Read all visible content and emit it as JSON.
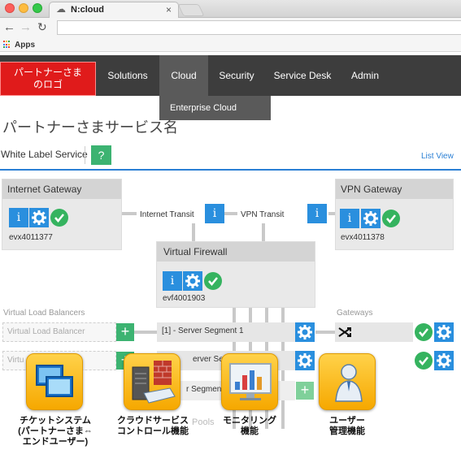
{
  "browser": {
    "tab_title": "N:cloud",
    "tab_close": "×",
    "apps_label": "Apps"
  },
  "navbar": {
    "logo_text": "パートナーさまのロゴ",
    "items": [
      {
        "label": "Solutions"
      },
      {
        "label": "Cloud"
      },
      {
        "label": "Security"
      },
      {
        "label": "Service Desk"
      },
      {
        "label": "Admin"
      }
    ],
    "dropdown_item": "Enterprise Cloud"
  },
  "page": {
    "title": "パートナーさまサービス名",
    "service_label": "White Label Service",
    "help_label": "?",
    "list_view": "List View"
  },
  "diagram": {
    "internet_gateway": {
      "title": "Internet Gateway",
      "id": "evx4011377"
    },
    "vpn_gateway": {
      "title": "VPN Gateway",
      "id": "evx4011378"
    },
    "internet_transit": "Internet Transit",
    "vpn_transit": "VPN Transit",
    "virtual_firewall": {
      "title": "Virtual Firewall",
      "id": "evf4001903"
    },
    "info_label": "i",
    "vlb_section": "Virtual Load Balancers",
    "vlb_item_1": "Virtual Load Balancer",
    "vlb_item_2": "Virtu",
    "gateways_section": "Gateways",
    "segment_1": "[1] - Server Segment 1",
    "segment_2": "erver Segm",
    "segment_3": "r Segment",
    "pools_label": "Pools",
    "plus_label": "+"
  },
  "features": [
    {
      "caption": "チケットシステム\n(パートナーさま⇔\nエンドユーザー)"
    },
    {
      "caption": "クラウドサービス\nコントロール機能"
    },
    {
      "caption": "モニタリング\n機能"
    },
    {
      "caption": "ユーザー\n管理機能"
    }
  ],
  "colors": {
    "brand_red": "#e01b1b",
    "nav_dark": "#3d3d3d",
    "action_blue": "#2a8fde",
    "success_green": "#35b35f",
    "tile_gold": "#f6a800"
  }
}
